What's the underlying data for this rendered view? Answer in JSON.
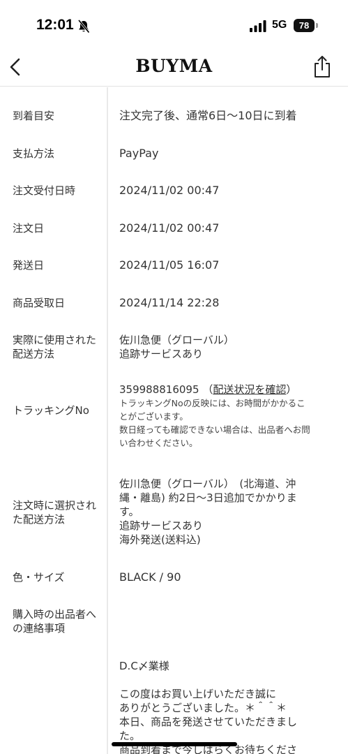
{
  "status": {
    "time": "12:01",
    "network": "5G",
    "battery": "78"
  },
  "nav": {
    "brand": "BUYMA"
  },
  "details": [
    {
      "label": "到着目安",
      "value": "注文完了後、通常6日〜10日に到着"
    },
    {
      "label": "支払方法",
      "value": "PayPay"
    },
    {
      "label": "注文受付日時",
      "value": "2024/11/02 00:47"
    },
    {
      "label": "注文日",
      "value": "2024/11/02 00:47"
    },
    {
      "label": "発送日",
      "value": "2024/11/05 16:07"
    },
    {
      "label": "商品受取日",
      "value": "2024/11/14 22:28"
    },
    {
      "label": "実際に使用された配送方法",
      "value_lines": [
        "佐川急便（グローバル）",
        "追跡サービスあり"
      ]
    },
    {
      "label": "トラッキングNo",
      "tracking_number": "359988816095",
      "tracking_link_open": "（",
      "tracking_link": "配送状況を確認",
      "tracking_link_close": "）",
      "tracking_note_lines": [
        "トラッキングNoの反映には、お時間がかかるこ",
        "とがございます。",
        "数日経っても確認できない場合は、出品者へお問",
        "い合わせください。"
      ]
    },
    {
      "label": "注文時に選択された配送方法",
      "value_lines": [
        "佐川急便（グローバル）　(北海道、沖",
        "縄・離島) 約2日〜3日追加でかかりま",
        "す。",
        "追跡サービスあり",
        "海外発送(送料込)"
      ]
    },
    {
      "label": "色・サイズ",
      "value": "BLACK / 90"
    },
    {
      "label": "購入時の出品者への連絡事項",
      "value": ""
    }
  ],
  "message": {
    "lines": [
      "D.C〆業様",
      "",
      "この度はお買い上げいただき誠に",
      "ありがとうございました。＊＾＾＊",
      "本日、商品を発送させていただきまし",
      "た。",
      "商品到着まで今しばらくお待ちくださ"
    ]
  }
}
